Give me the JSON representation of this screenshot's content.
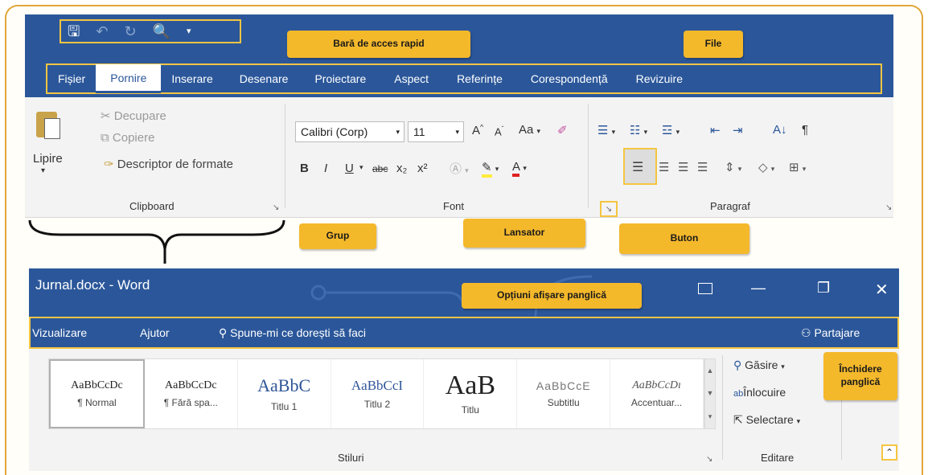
{
  "callouts": {
    "qat": "Bară de acces rapid",
    "tabs": "File",
    "group": "Grup",
    "launcher": "Lansator",
    "button": "Buton",
    "ribbon_options": "Opțiuni afișare panglică",
    "collapse": "Închidere panglică"
  },
  "tabs": [
    "Fișier",
    "Pornire",
    "Inserare",
    "Desenare",
    "Proiectare",
    "Aspect",
    "Referințe",
    "Corespondență",
    "Revizuire"
  ],
  "clipboard": {
    "paste": "Lipire",
    "cut": "Decupare",
    "copy": "Copiere",
    "format_painter": "Descriptor de formate",
    "label": "Clipboard"
  },
  "font": {
    "name": "Calibri (Corp)",
    "size": "11",
    "label": "Font",
    "case_button": "Aa",
    "bold": "B",
    "italic": "I",
    "underline": "U",
    "strike": "abc",
    "subscript": "x₂",
    "superscript": "x²",
    "color": "A"
  },
  "paragraph": {
    "label": "Paragraf",
    "sort": "A↓",
    "pilcrow": "¶"
  },
  "window": {
    "title": "Jurnal.docx  -  Word"
  },
  "tellbar": {
    "view": "Vizualizare",
    "help": "Ajutor",
    "tell_me": "Spune-mi ce dorești să faci",
    "share": "Partajare"
  },
  "styles": {
    "label": "Stiluri",
    "items": [
      {
        "sample": "AaBbCcDc",
        "name": "¶ Normal"
      },
      {
        "sample": "AaBbCcDc",
        "name": "¶ Fără spa..."
      },
      {
        "sample": "AaBbC",
        "name": "Titlu 1"
      },
      {
        "sample": "AaBbCcI",
        "name": "Titlu 2"
      },
      {
        "sample": "AaB",
        "name": "Titlu"
      },
      {
        "sample": "AaBbCcE",
        "name": "Subtitlu"
      },
      {
        "sample": "AaBbCcDı",
        "name": "Accentuar..."
      }
    ]
  },
  "editing": {
    "label": "Editare",
    "find": "Găsire",
    "replace": "Înlocuire",
    "select": "Selectare"
  },
  "colors": {
    "ribbon_blue": "#2b579a",
    "highlight": "#f5c542",
    "callout": "#f4b82b"
  }
}
